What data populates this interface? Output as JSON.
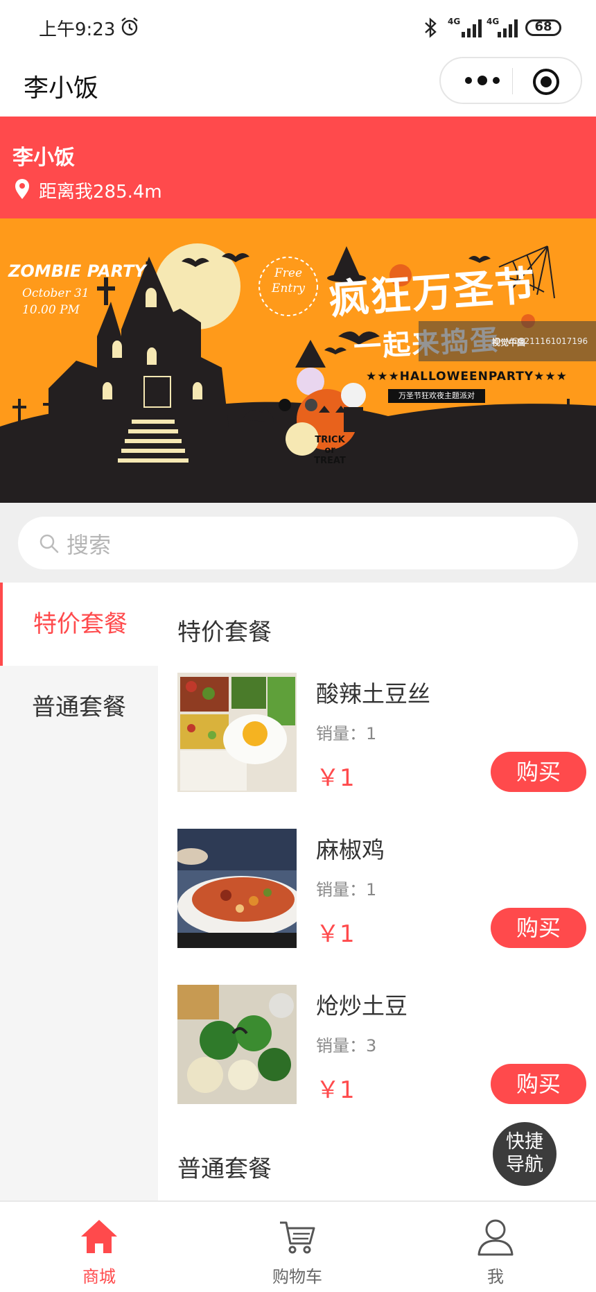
{
  "status_bar": {
    "time": "上午9:23",
    "network1": "4G",
    "network2": "4G",
    "battery": "68"
  },
  "nav": {
    "title": "李小饭"
  },
  "shop": {
    "name": "李小饭",
    "distance": "距离我285.4m"
  },
  "banner": {
    "zombie": "ZOMBIE PARTY",
    "date": "October 31",
    "time": "10.00 PM",
    "free_line1": "Free",
    "free_line2": "Entry",
    "title_line1": "疯狂万圣节",
    "title_line2": "一起来捣蛋",
    "party": "★★★HALLOWEENPARTY★★★",
    "tag": "万圣节狂欢夜主题派对",
    "trick_line1": "TRICK",
    "trick_line2": "or",
    "trick_line3": "TREAT",
    "watermark_brand": "视觉中国",
    "watermark_id": "ID: VCG211161017196",
    "slide_count": 2,
    "active_slide": 0
  },
  "search": {
    "placeholder": "搜索"
  },
  "sidebar": {
    "items": [
      {
        "label": "特价套餐",
        "active": true
      },
      {
        "label": "普通套餐",
        "active": false
      }
    ]
  },
  "content": {
    "sections": [
      {
        "title": "特价套餐",
        "products": [
          {
            "name": "酸辣土豆丝",
            "sales": "销量：1",
            "price": "￥1",
            "buy": "购买"
          },
          {
            "name": "麻椒鸡",
            "sales": "销量：1",
            "price": "￥1",
            "buy": "购买"
          },
          {
            "name": "炝炒土豆",
            "sales": "销量：3",
            "price": "￥1",
            "buy": "购买"
          }
        ]
      },
      {
        "title": "普通套餐"
      }
    ]
  },
  "fab": {
    "line1": "快捷",
    "line2": "导航"
  },
  "tabbar": {
    "items": [
      {
        "label": "商城",
        "icon": "home-icon",
        "active": true
      },
      {
        "label": "购物车",
        "icon": "cart-icon",
        "active": false
      },
      {
        "label": "我",
        "icon": "user-icon",
        "active": false
      }
    ]
  },
  "colors": {
    "accent": "#ff4a4c",
    "banner_orange": "#ff9a1a",
    "fab": "#3c3c3c"
  }
}
